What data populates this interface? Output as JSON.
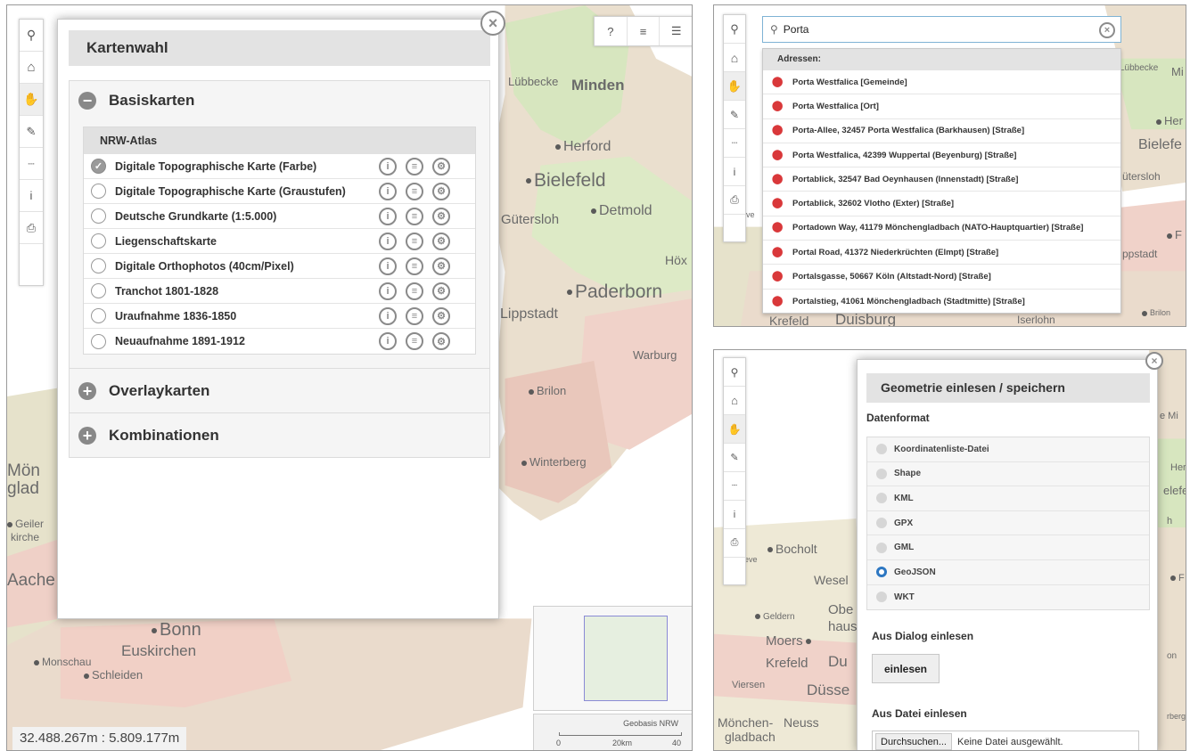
{
  "main_view": {
    "toolbar": {
      "top_right": [
        "?",
        "≡",
        "☰"
      ]
    },
    "kartenwahl": {
      "title": "Kartenwahl",
      "close_glyph": "×",
      "sections": {
        "basiskarten": "Basiskarten",
        "overlaykarten": "Overlaykarten",
        "kombinationen": "Kombinationen"
      },
      "group_title": "NRW-Atlas",
      "maps": [
        "Digitale Topographische Karte (Farbe)",
        "Digitale Topographische Karte (Graustufen)",
        "Deutsche Grundkarte (1:5.000)",
        "Liegenschaftskarte",
        "Digitale Orthophotos (40cm/Pixel)",
        "Tranchot 1801-1828",
        "Uraufnahme 1836-1850",
        "Neuaufnahme 1891-1912"
      ],
      "selected_index": 0,
      "row_icons": [
        "info-icon",
        "legend-icon",
        "settings-icon"
      ]
    },
    "cities": [
      "Lübbecke",
      "Minden",
      "Herford",
      "Bielefeld",
      "Gütersloh",
      "Detmold",
      "Höx",
      "Paderborn",
      "Lippstadt",
      "Warburg",
      "Brilon",
      "Winterberg",
      "Mön",
      "glad",
      "Geiler",
      "kirche",
      "Aache",
      "Bonn",
      "Euskirchen",
      "Monschau",
      "Schleiden"
    ],
    "coordinates": "32.488.267m : 5.809.177m",
    "scale": {
      "source": "Geobasis NRW",
      "ticks": [
        "0",
        "20km",
        "40"
      ]
    }
  },
  "search_view": {
    "query": "Porta",
    "header": "Adressen:",
    "results": [
      "Porta Westfalica [Gemeinde]",
      "Porta Westfalica [Ort]",
      "Porta-Allee, 32457 Porta Westfalica (Barkhausen) [Straße]",
      "Porta Westfalica, 42399 Wuppertal (Beyenburg) [Straße]",
      "Portablick, 32547 Bad Oeynhausen (Innenstadt) [Straße]",
      "Portablick, 32602 Vlotho (Exter) [Straße]",
      "Portadown Way, 41179 Mönchengladbach (NATO-Hauptquartier) [Straße]",
      "Portal Road, 41372 Niederkrüchten (Elmpt) [Straße]",
      "Portalsgasse, 50667 Köln (Altstadt-Nord) [Straße]",
      "Portalstieg, 41061 Mönchengladbach (Stadtmitte) [Straße]"
    ],
    "cities": [
      "Lübbecke",
      "Mi",
      "Her",
      "Bielefe",
      "ütersloh",
      "ve",
      "F",
      "ppstadt",
      "Krefeld",
      "Duisburg",
      "Iserlohn",
      "Brilon"
    ]
  },
  "geometry_view": {
    "title": "Geometrie einlesen / speichern",
    "format_label": "Datenformat",
    "formats": [
      "Koordinatenliste-Datei",
      "Shape",
      "KML",
      "GPX",
      "GML",
      "GeoJSON",
      "WKT"
    ],
    "selected_format_index": 5,
    "dialog_label": "Aus Dialog einlesen",
    "dialog_button": "einlesen",
    "file_label": "Aus Datei einlesen",
    "file_button": "Durchsuchen...",
    "file_status": "Keine Datei ausgewählt.",
    "cities": [
      "e Mi",
      "Her",
      "elefe",
      "Bocholt",
      "eve",
      "Wesel",
      "Geldern",
      "Obe",
      "haus",
      "Moers",
      "Krefeld",
      "Du",
      "Viersen",
      "Düsse",
      "Mönchen-",
      "Neuss",
      "gladbach",
      "on",
      "rberg",
      "h",
      "F"
    ]
  },
  "colors": {
    "map_bg": "#f3efe6",
    "map_green": "#d9e8c2",
    "map_red": "#efc9c1",
    "accent_blue": "#2d77c2",
    "pin_red": "#d9383a"
  }
}
